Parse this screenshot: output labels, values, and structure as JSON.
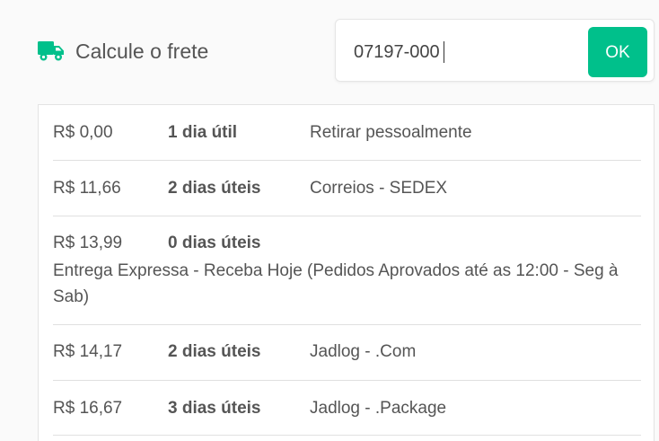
{
  "header": {
    "title": "Calcule o frete",
    "truck_icon": "truck-icon",
    "accent_color": "#00c08b"
  },
  "search": {
    "cep_value": "07197-000",
    "ok_label": "OK"
  },
  "shipping_options": [
    {
      "price": "R$ 0,00",
      "days": "1 dia útil",
      "carrier": "Retirar pessoalmente"
    },
    {
      "price": "R$ 11,66",
      "days": "2 dias úteis",
      "carrier": "Correios - SEDEX"
    },
    {
      "price": "R$ 13,99",
      "days": "0 dias úteis",
      "carrier": "Entrega Expressa - Receba Hoje (Pedidos Aprovados até as 12:00 - Seg à Sab)"
    },
    {
      "price": "R$ 14,17",
      "days": "2 dias úteis",
      "carrier": "Jadlog - .Com"
    },
    {
      "price": "R$ 16,67",
      "days": "3 dias úteis",
      "carrier": "Jadlog - .Package"
    }
  ]
}
